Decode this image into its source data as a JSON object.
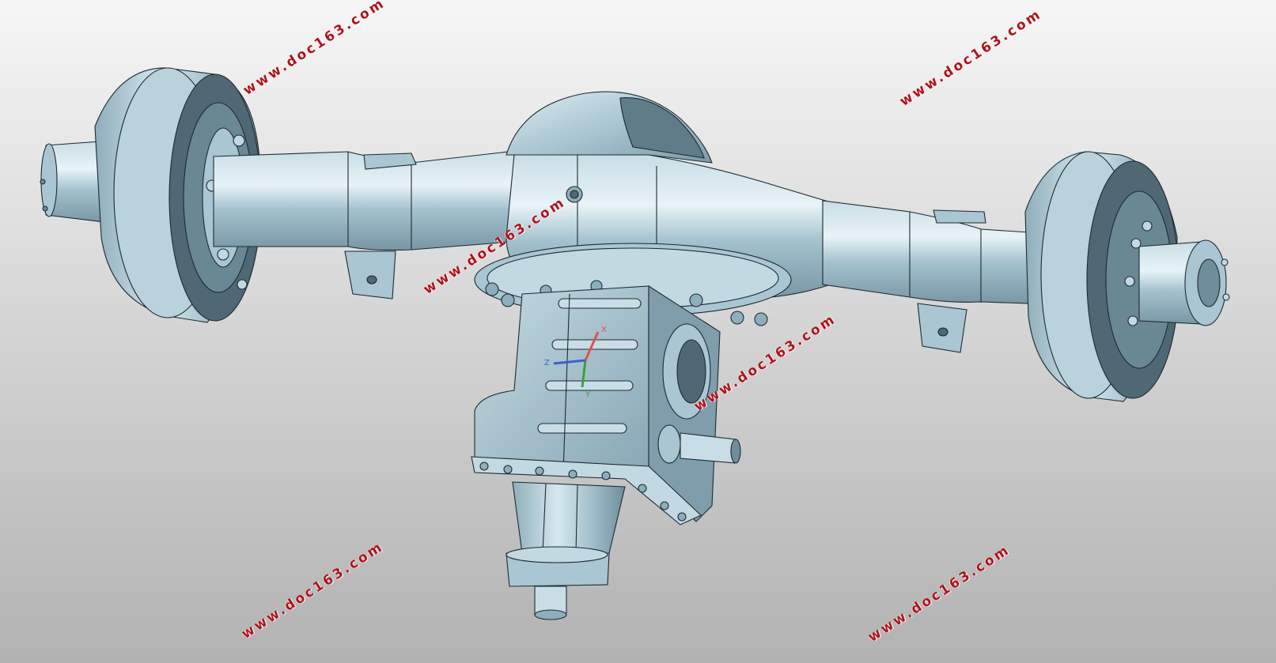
{
  "viewport": {
    "background_top": "#f6f6f6",
    "background_bottom": "#b2b2b2"
  },
  "model": {
    "body_color": "#a9c6d2",
    "shade_color": "#7f9dab",
    "dark_color": "#4f6873",
    "highlight_color": "#e2f0f5",
    "edge_color": "#1e2a30"
  },
  "triad": {
    "x_label": "X",
    "y_label": "Y",
    "z_label": "Z",
    "x_color": "#e05050",
    "y_color": "#3ca03c",
    "z_color": "#3f5fd0"
  },
  "watermark": {
    "text": "www.doc163.com",
    "color": "#b0121c"
  }
}
